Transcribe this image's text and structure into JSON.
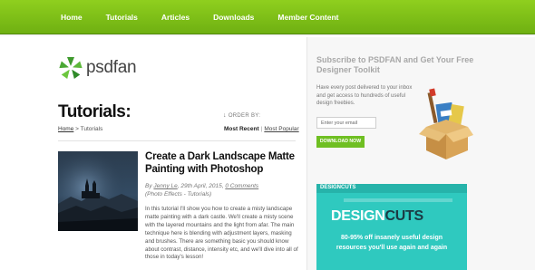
{
  "nav": {
    "items": [
      "Home",
      "Tutorials",
      "Articles",
      "Downloads",
      "Member Content"
    ]
  },
  "logo": {
    "text": "psdfan",
    "icon": "leaf-flower-icon"
  },
  "page": {
    "title": "Tutorials:",
    "breadcrumb": {
      "home": "Home",
      "separator": " > ",
      "current": "Tutorials"
    },
    "order_by": {
      "label": "ORDER BY:",
      "active": "Most Recent",
      "separator": "|",
      "other": "Most Popular"
    }
  },
  "post": {
    "title": "Create a Dark Landscape Matte Painting with Photoshop",
    "meta": {
      "by": "By",
      "author": "Jenny Le",
      "date": ", 29th April, 2015,",
      "comments": "0 Comments"
    },
    "category": "(Photo Effects - Tutorials)",
    "excerpt": "In this tutorial I'll show you how to create a misty landscape matte painting with a dark castle. We'll create a misty scene with the layered mountains and the light from afar. The main technique here is blending with adjustment layers, masking and brushes. There are something basic you should know about contrast, distance, intensity etc, and we'll dive into all of those in today's lesson!"
  },
  "sidebar": {
    "title": "Subscribe to PSDFAN and Get Your Free Designer Toolkit",
    "description": "Have every post delivered to your inbox and get access to hundreds of useful design freebies.",
    "email_placeholder": "Enter your email",
    "button": "DOWNLOAD NOW",
    "ad": {
      "small": "DESIGNCUTS",
      "big_a": "DESIGN",
      "big_b": "CUTS",
      "line1": "80-95% off insanely useful design",
      "line2": "resources you'll use again and again"
    }
  },
  "colors": {
    "nav_green": "#7cc01a",
    "button_green": "#6fbf22",
    "ad_teal": "#2fc9bf"
  }
}
